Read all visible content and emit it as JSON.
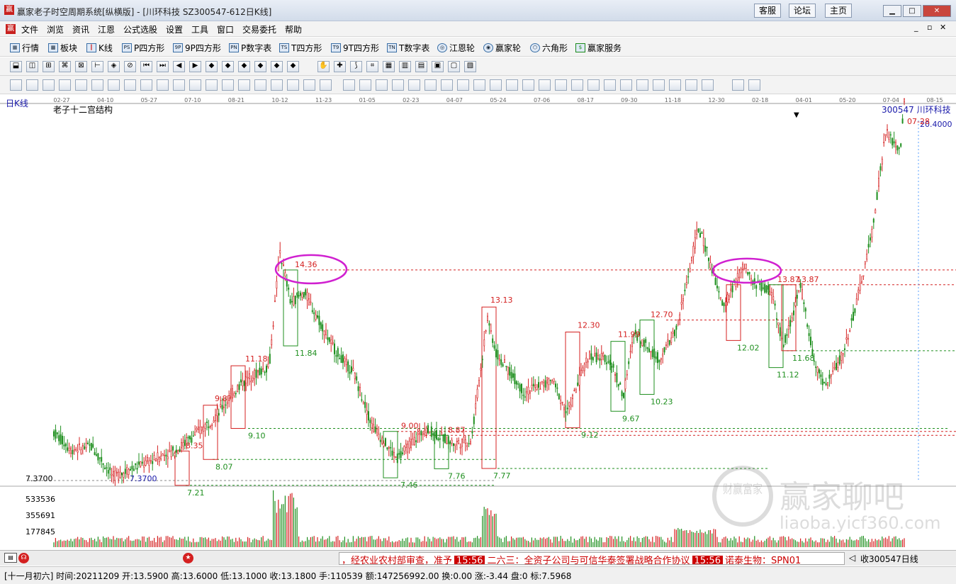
{
  "window": {
    "title": "赢家老子时空周期系统[纵横版] - [川环科技  SZ300547-612日K线]",
    "buttons": [
      "客服",
      "论坛",
      "主页"
    ]
  },
  "menu": [
    "文件",
    "浏览",
    "资讯",
    "江恩",
    "公式选股",
    "设置",
    "工具",
    "窗口",
    "交易委托",
    "帮助"
  ],
  "toolbar1": [
    {
      "label": "行情",
      "icon": "grid-icon"
    },
    {
      "label": "板块",
      "icon": "blocks-icon"
    },
    {
      "label": "K线",
      "icon": "candles-icon"
    },
    {
      "label": "P四方形",
      "icon": "ps-icon",
      "badge": "PS"
    },
    {
      "label": "9P四方形",
      "icon": "9p-icon",
      "badge": "9P"
    },
    {
      "label": "P数字表",
      "icon": "pn-icon",
      "badge": "PN"
    },
    {
      "label": "T四方形",
      "icon": "ts-icon",
      "badge": "TS"
    },
    {
      "label": "9T四方形",
      "icon": "9t-icon",
      "badge": "T9"
    },
    {
      "label": "T数字表",
      "icon": "tn-icon",
      "badge": "TN"
    },
    {
      "label": "江恩轮",
      "icon": "gann-wheel-icon"
    },
    {
      "label": "赢家轮",
      "icon": "winner-wheel-icon"
    },
    {
      "label": "六角形",
      "icon": "hexagon-icon"
    },
    {
      "label": "赢家服务",
      "icon": "dollar-icon"
    }
  ],
  "chart": {
    "period_label": "日K线",
    "indicator_title": "老子十二宫结构",
    "symbol_label": "300547  川环科技",
    "top_price": "20.4000",
    "last_date": "07-28",
    "low_marker": "7.3700",
    "low_axis": "7.3700",
    "date_ticks": [
      "02-27",
      "04-10",
      "05-27",
      "07-10",
      "08-21",
      "10-12",
      "11-23",
      "01-05",
      "02-23",
      "04-07",
      "05-24",
      "07-06",
      "08-17",
      "09-30",
      "11-18",
      "12-30",
      "02-18",
      "04-01",
      "05-20",
      "07-04",
      "08-15"
    ],
    "price_labels": {
      "red": [
        "14.36",
        "11.18",
        "9.87",
        "8.35",
        "9.00",
        "8.87",
        "13.13",
        "12.30",
        "11.99",
        "12.70",
        "13.87",
        "13.87"
      ],
      "green": [
        "11.84",
        "9.10",
        "8.07",
        "7.21",
        "7.46",
        "7.76",
        "7.77",
        "9.12",
        "9.67",
        "10.23",
        "12.02",
        "11.12",
        "11.68"
      ]
    },
    "volume_axis": [
      "533536",
      "355691",
      "177845"
    ]
  },
  "watermark": {
    "brand": "赢家聊吧",
    "url": "liaoba.yicf360.com",
    "seal": "财赢富家"
  },
  "statusbar": {
    "ticker": [
      {
        "text": "，经农业农村部审查，准予",
        "style": "red"
      },
      {
        "text": "15:56",
        "style": "time"
      },
      {
        "text": "二六三：全资子公司与可信华泰签署战略合作协议",
        "style": "red"
      },
      {
        "text": "15:56",
        "style": "time"
      },
      {
        "text": "诺泰生物：SPN01",
        "style": "red"
      }
    ],
    "symbol": "收300547日线"
  },
  "infobar": {
    "text": "[十一月初六] 时间:20211209 开:13.5900 高:13.6000 低:13.1000 收:13.1800 手:110539 额:147256992.00 换:0.00 涨:-3.44 盘:0 标:7.5968"
  },
  "colors": {
    "up": "#d42020",
    "down": "#1f8f1f",
    "accent": "#d020d0",
    "blue": "#1a1aaa"
  }
}
